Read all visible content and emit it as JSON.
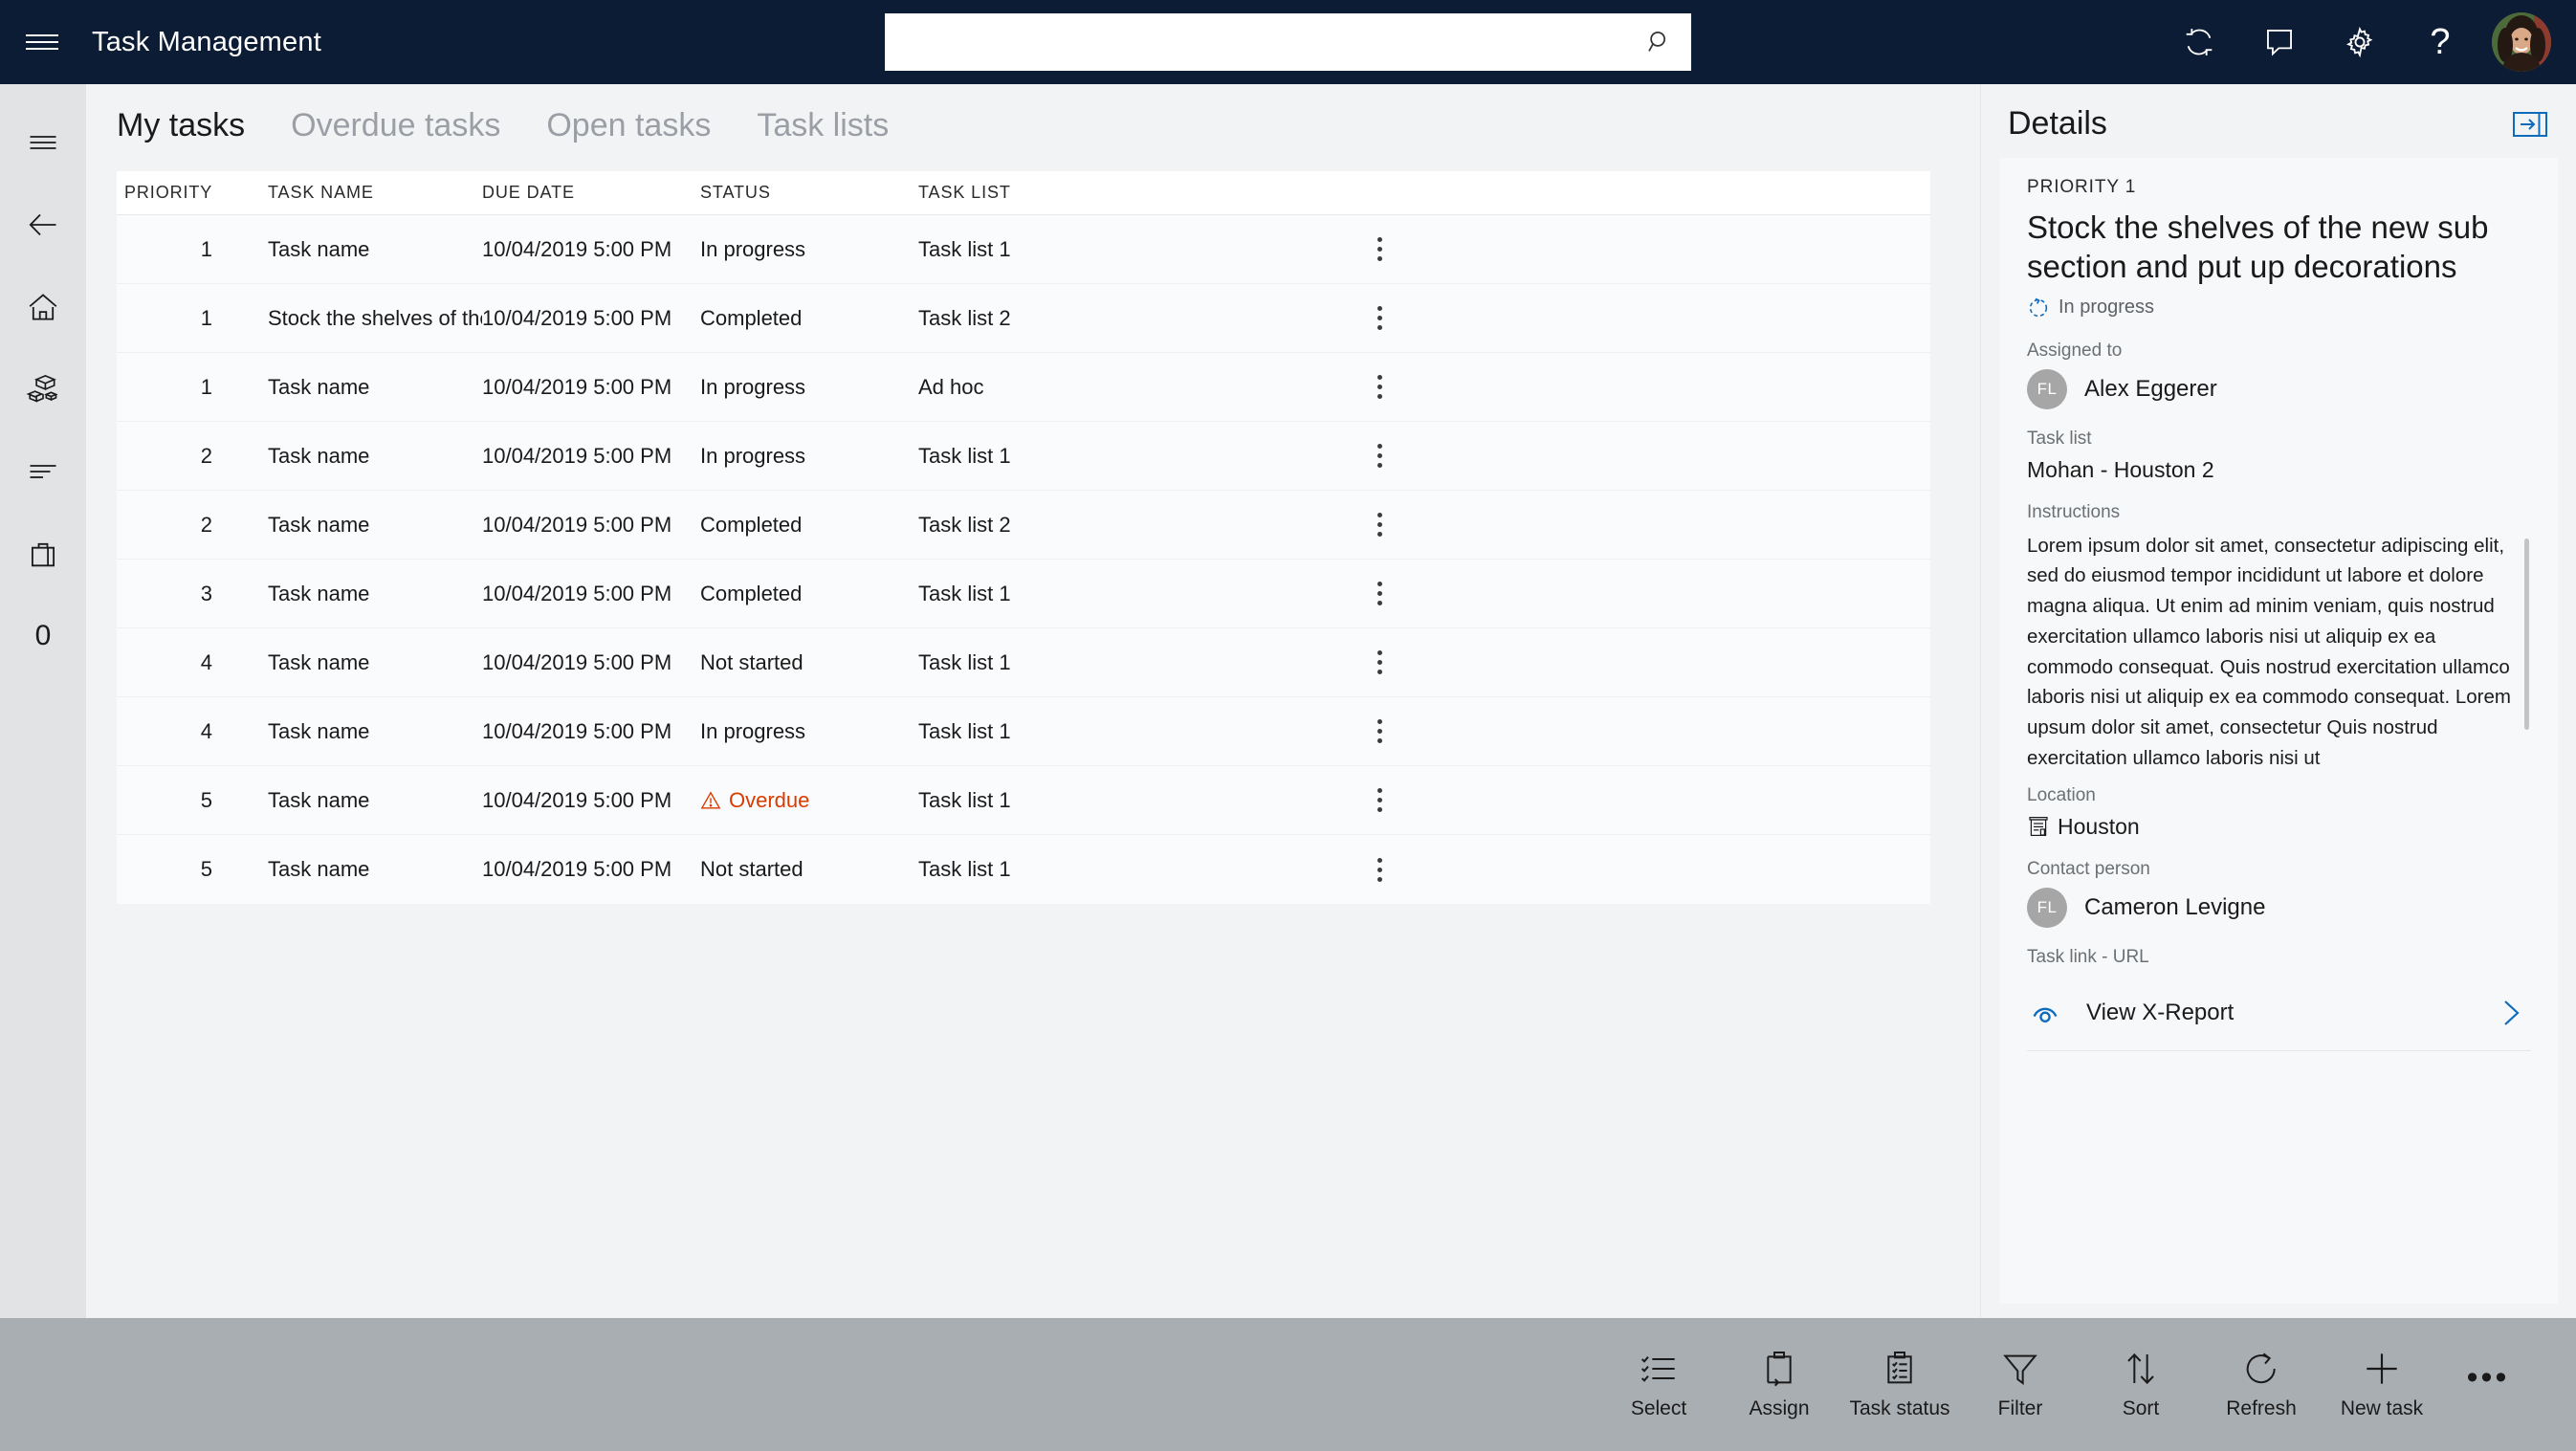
{
  "topnav": {
    "title": "Task Management",
    "menu_icon": "hamburger-icon",
    "search": {
      "value": "",
      "placeholder": ""
    },
    "icons": [
      {
        "name": "refresh-icon",
        "label": "Refresh"
      },
      {
        "name": "feedback-icon",
        "label": "Feedback"
      },
      {
        "name": "settings-gear-icon",
        "label": "Settings"
      },
      {
        "name": "help-icon",
        "label": "?"
      }
    ],
    "avatar": {
      "name": "user-avatar",
      "alt": "User profile"
    }
  },
  "rail": {
    "items": [
      {
        "name": "rail-hamburger-icon",
        "label": "Menu"
      },
      {
        "name": "rail-back-arrow-icon",
        "label": "Back"
      },
      {
        "name": "rail-home-icon",
        "label": "Home"
      },
      {
        "name": "rail-products-icon",
        "label": "Products"
      },
      {
        "name": "rail-list-icon",
        "label": "Lists"
      },
      {
        "name": "rail-bag-icon",
        "label": "Cart"
      },
      {
        "name": "rail-count",
        "label": "0"
      }
    ]
  },
  "tabs": [
    {
      "label": "My tasks",
      "active": true
    },
    {
      "label": "Overdue tasks",
      "active": false
    },
    {
      "label": "Open tasks",
      "active": false
    },
    {
      "label": "Task lists",
      "active": false
    }
  ],
  "grid": {
    "columns": [
      "PRIORITY",
      "TASK NAME",
      "DUE DATE",
      "STATUS",
      "TASK LIST"
    ],
    "rows": [
      {
        "priority": "1",
        "name": "Task name",
        "due": "10/04/2019 5:00 PM",
        "status": "In progress",
        "overdue": false,
        "list": "Task list 1"
      },
      {
        "priority": "1",
        "name": "Stock the shelves of the new sub section...",
        "due": "10/04/2019 5:00 PM",
        "status": "Completed",
        "overdue": false,
        "list": "Task list 2"
      },
      {
        "priority": "1",
        "name": "Task name",
        "due": "10/04/2019 5:00 PM",
        "status": "In progress",
        "overdue": false,
        "list": "Ad hoc"
      },
      {
        "priority": "2",
        "name": "Task name",
        "due": "10/04/2019 5:00 PM",
        "status": "In progress",
        "overdue": false,
        "list": "Task list 1"
      },
      {
        "priority": "2",
        "name": "Task name",
        "due": "10/04/2019 5:00 PM",
        "status": "Completed",
        "overdue": false,
        "list": "Task list 2"
      },
      {
        "priority": "3",
        "name": "Task name",
        "due": "10/04/2019 5:00 PM",
        "status": "Completed",
        "overdue": false,
        "list": "Task list 1"
      },
      {
        "priority": "4",
        "name": "Task name",
        "due": "10/04/2019 5:00 PM",
        "status": "Not started",
        "overdue": false,
        "list": "Task list 1"
      },
      {
        "priority": "4",
        "name": "Task name",
        "due": "10/04/2019 5:00 PM",
        "status": "In progress",
        "overdue": false,
        "list": "Task list 1"
      },
      {
        "priority": "5",
        "name": "Task name",
        "due": "10/04/2019 5:00 PM",
        "status": "Overdue",
        "overdue": true,
        "list": "Task list 1"
      },
      {
        "priority": "5",
        "name": "Task name",
        "due": "10/04/2019 5:00 PM",
        "status": "Not started",
        "overdue": false,
        "list": "Task list 1"
      }
    ]
  },
  "details": {
    "header": "Details",
    "collapse_icon": "collapse-panel-icon",
    "priority": "PRIORITY 1",
    "task_title": "Stock the shelves of the new sub section and put up decorations",
    "status": "In progress",
    "status_icon": "in-progress-icon",
    "assigned_to_label": "Assigned to",
    "assigned_to_name": "Alex Eggerer",
    "assigned_to_initials": "FL",
    "task_list_label": "Task list",
    "task_list_value": "Mohan - Houston 2",
    "instructions_label": "Instructions",
    "instructions_text": "Lorem ipsum dolor sit amet, consectetur adipiscing elit, sed do eiusmod tempor incididunt ut labore et dolore magna aliqua. Ut enim ad minim veniam, quis nostrud exercitation ullamco laboris nisi ut aliquip ex ea commodo consequat. Quis nostrud exercitation ullamco laboris nisi ut aliquip ex ea commodo consequat. Lorem upsum dolor sit amet, consectetur Quis nostrud exercitation ullamco laboris nisi ut",
    "location_label": "Location",
    "location_value": "Houston",
    "location_icon": "store-icon",
    "contact_label": "Contact person",
    "contact_name": "Cameron Levigne",
    "contact_initials": "FL",
    "task_link_label": "Task link - URL",
    "task_link_text": "View X-Report",
    "task_link_icon": "eye-icon",
    "task_link_chevron": "chevron-right-icon"
  },
  "actionbar": {
    "items": [
      {
        "label": "Select",
        "icon": "select-list-icon"
      },
      {
        "label": "Assign",
        "icon": "assign-clipboard-icon"
      },
      {
        "label": "Task status",
        "icon": "task-status-clipboard-icon"
      },
      {
        "label": "Filter",
        "icon": "filter-funnel-icon"
      },
      {
        "label": "Sort",
        "icon": "sort-arrows-icon"
      },
      {
        "label": "Refresh",
        "icon": "refresh-circle-icon"
      },
      {
        "label": "New task",
        "icon": "plus-icon"
      }
    ],
    "overflow_label": "•••"
  },
  "colors": {
    "nav_bg": "#0d1c35",
    "accent_blue": "#0f6cbd",
    "overdue_red": "#da3b01",
    "actionbar_bg": "#a9aeb3",
    "page_bg": "#f2f3f5"
  }
}
